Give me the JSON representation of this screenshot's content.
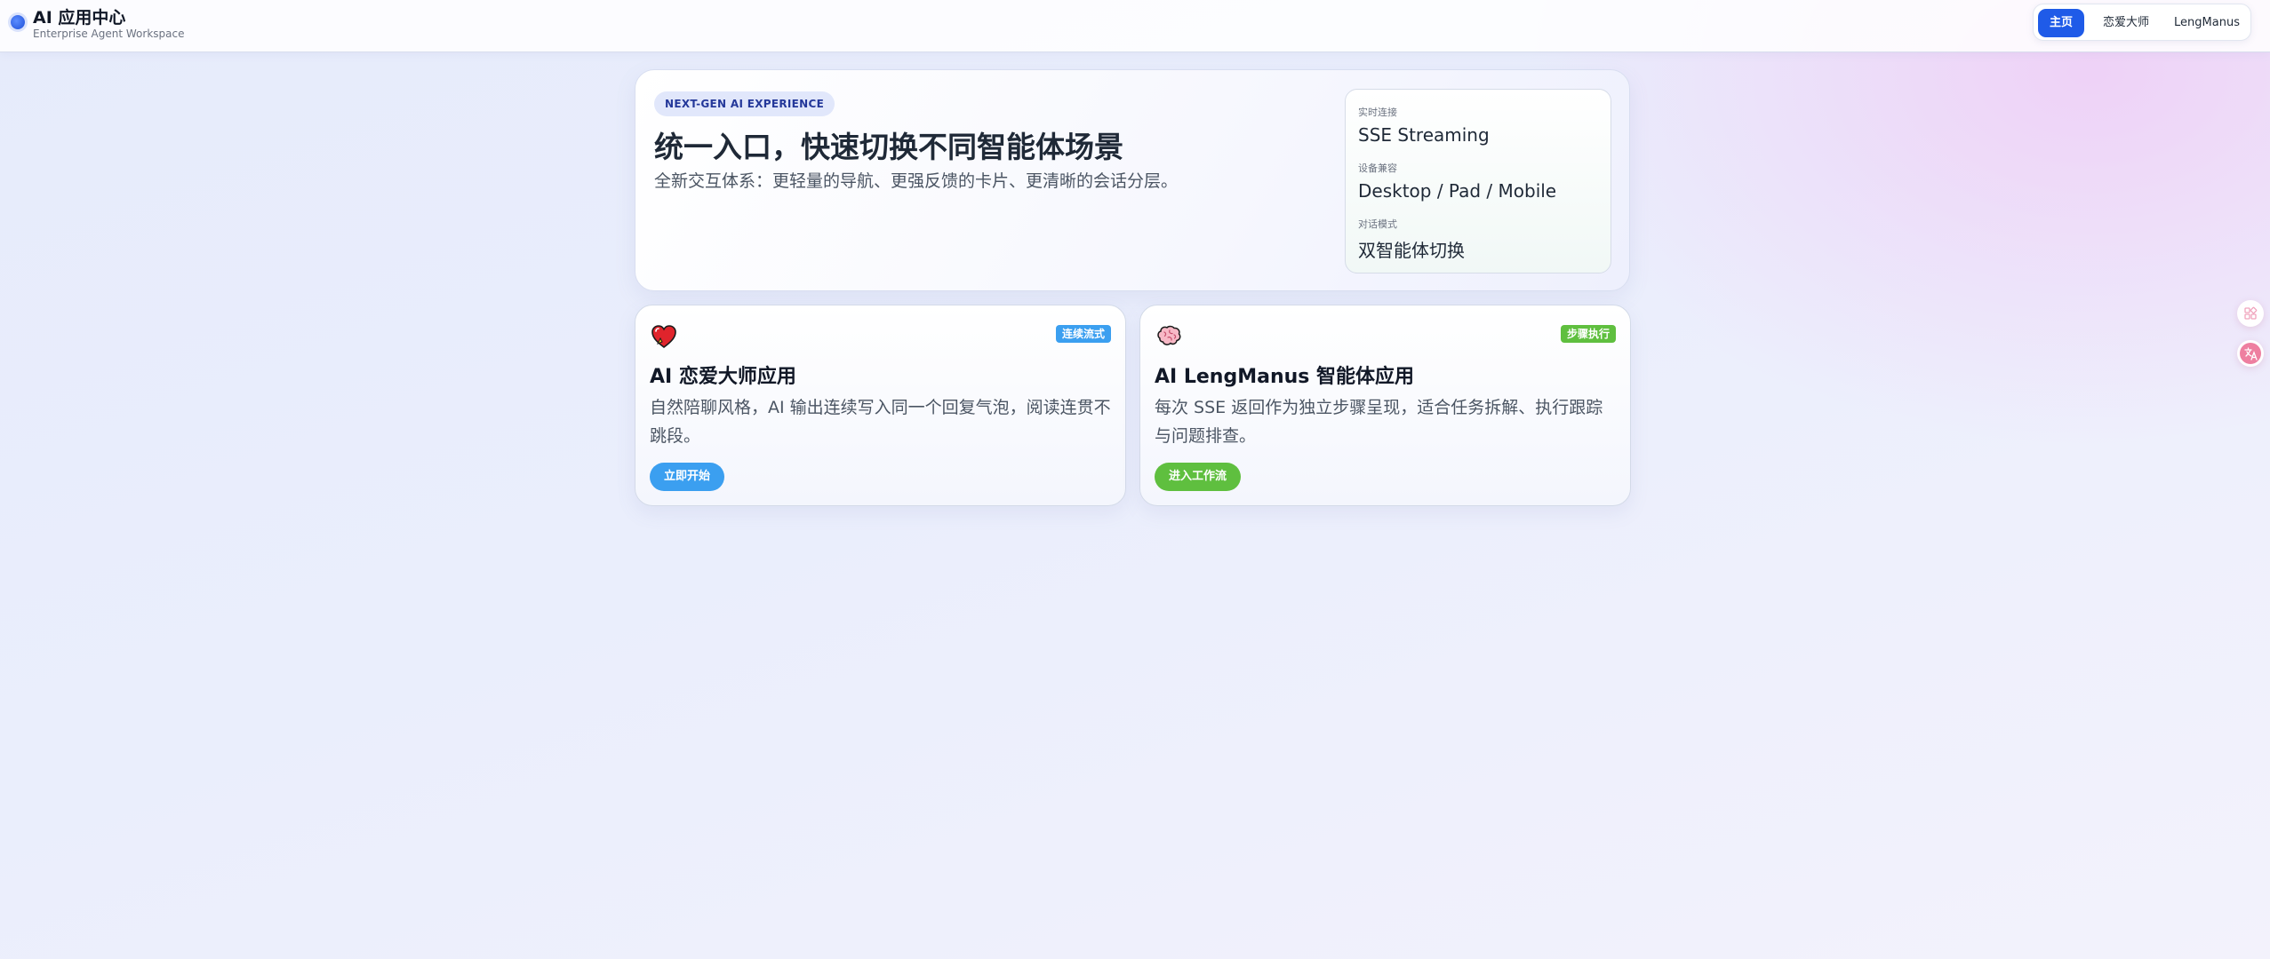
{
  "app": {
    "title": "AI 应用中心",
    "subtitle": "Enterprise Agent Workspace"
  },
  "nav": {
    "items": [
      {
        "label": "主页",
        "active": true
      },
      {
        "label": "恋爱大师",
        "active": false
      },
      {
        "label": "LengManus",
        "active": false
      }
    ]
  },
  "hero": {
    "tag": "NEXT-GEN AI EXPERIENCE",
    "title": "统一入口，快速切换不同智能体场景",
    "description": "全新交互体系：更轻量的导航、更强反馈的卡片、更清晰的会话分层。",
    "info": [
      {
        "label": "实时连接",
        "value": "SSE Streaming"
      },
      {
        "label": "设备兼容",
        "value": "Desktop / Pad / Mobile"
      },
      {
        "label": "对话模式",
        "value": "双智能体切换"
      }
    ]
  },
  "cards": [
    {
      "icon": "heart-icon",
      "badge": "连续流式",
      "badge_color": "#3b9ff0",
      "title": "AI 恋爱大师应用",
      "description": "自然陪聊风格，AI 输出连续写入同一个回复气泡，阅读连贯不跳段。",
      "button": "立即开始",
      "button_color": "#3b9ff0"
    },
    {
      "icon": "brain-icon",
      "badge": "步骤执行",
      "badge_color": "#5fbf3f",
      "title": "AI LengManus 智能体应用",
      "description": "每次 SSE 返回作为独立步骤呈现，适合任务拆解、执行跟踪与问题排查。",
      "button": "进入工作流",
      "button_color": "#5fbf3f"
    }
  ],
  "floating": [
    {
      "icon": "grid-icon"
    },
    {
      "icon": "translate-icon"
    }
  ],
  "colors": {
    "accent": "#1f5be8",
    "tag_bg": "#e1e7fb",
    "green": "#5fbf3f",
    "blue": "#3b9ff0"
  }
}
